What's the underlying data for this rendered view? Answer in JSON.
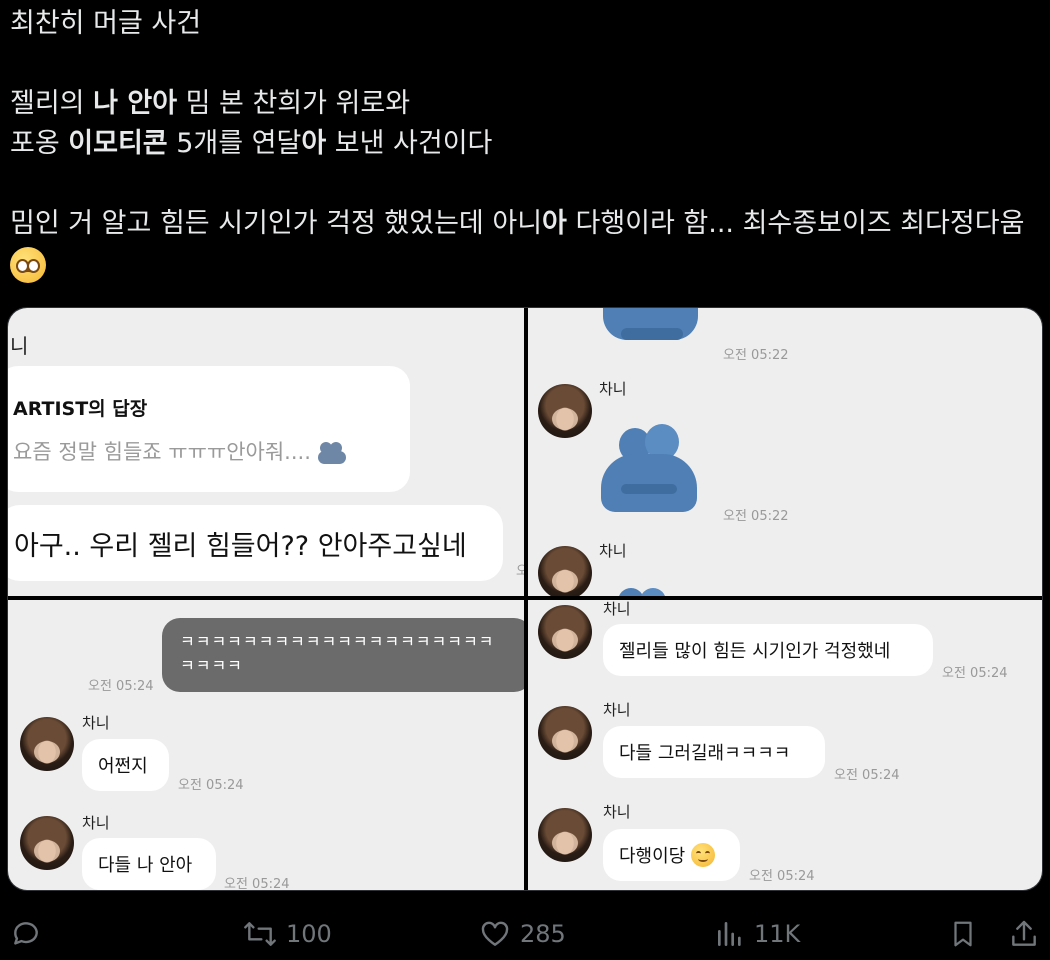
{
  "post": {
    "line1": "최찬히 머글 사건",
    "line2_a": "젤리의 ",
    "line2_b": "나 안아",
    "line2_c": " 밈 본 찬희가 위로와",
    "line3_a": "포옹 ",
    "line3_b": "이모티콘",
    "line3_c": " 5개를 연달",
    "line3_d": "아",
    "line3_e": " 보낸 사건이다",
    "line4_a": "밈인 거 알고 힘든 시기인가 걱정 했었는데 아니",
    "line4_b": "아",
    "line4_c": " 다행이라 함... 최수종보이즈 최다정다움",
    "emoji": "pleading-face"
  },
  "panel1": {
    "top_label": "니",
    "reply_title": "ARTIST의 답장",
    "reply_quote": "요즘 정말 힘들죠 ㅠㅠㅠ안아줘....",
    "message": "아구.. 우리 젤리 힘들어?? 안아주고싶네",
    "edge_char": "오"
  },
  "panel2": {
    "time1": "오전 05:22",
    "sender": "차니",
    "time2": "오전 05:22",
    "sender2": "차니"
  },
  "panel3": {
    "sent": "ㅋㅋㅋㅋㅋㅋㅋㅋㅋㅋㅋㅋㅋㅋㅋㅋㅋㅋㅋㅋ ㅋㅋㅋㅋ",
    "sent_time": "오전 05:24",
    "sender1": "차니",
    "msg1": "어쩐지",
    "time1": "오전 05:24",
    "sender2": "차니",
    "msg2": "다들 나 안아",
    "time2": "오전 05:24"
  },
  "panel4": {
    "sender1": "차니",
    "msg1": "젤리들 많이 힘든 시기인가 걱정했네",
    "time1": "오전 05:24",
    "sender2": "차니",
    "msg2": "다들 그러길래ㅋㅋㅋㅋ",
    "time2": "오전 05:24",
    "sender3": "차니",
    "msg3": "다행이당",
    "time3": "오전 05:24"
  },
  "actions": {
    "reply_icon": "reply-icon",
    "retweets": "100",
    "likes": "285",
    "views": "11K",
    "bookmark_icon": "bookmark-icon",
    "share_icon": "share-icon"
  },
  "colors": {
    "background": "#000000",
    "text": "#e7e9ea",
    "muted": "#71767b",
    "chat_bg": "#eeeeee",
    "sent_bubble": "#6b6b6b",
    "hug_blue": "#4f7fb5"
  }
}
